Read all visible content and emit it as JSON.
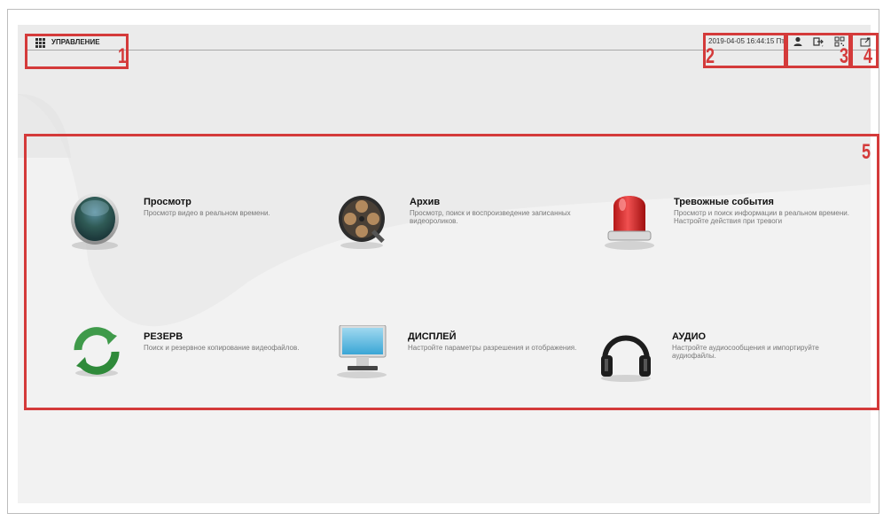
{
  "header": {
    "title": "УПРАВЛЕНИЕ",
    "datetime": "2019-04-05 16:44:15 Пт."
  },
  "toolbar": {
    "icons": [
      "user-icon",
      "logout-icon",
      "qr-code-icon",
      "fullscreen-icon"
    ]
  },
  "annotations": [
    "1",
    "2",
    "3",
    "4",
    "5"
  ],
  "tiles": [
    {
      "title": "Просмотр",
      "desc": "Просмотр видео в реальном времени.",
      "icon": "live-view-icon"
    },
    {
      "title": "Архив",
      "desc": "Просмотр, поиск и воспроизведение записанных видеороликов.",
      "icon": "film-reel-icon"
    },
    {
      "title": "Тревожные события",
      "desc": "Просмотр и поиск информации в реальном времени. Настройте действия при тревоги",
      "icon": "alarm-siren-icon"
    },
    {
      "title": "РЕЗЕРВ",
      "desc": "Поиск и резервное копирование видеофайлов.",
      "icon": "backup-arrows-icon"
    },
    {
      "title": "ДИСПЛЕЙ",
      "desc": "Настройте параметры разрешения и отображения.",
      "icon": "monitor-icon"
    },
    {
      "title": "АУДИО",
      "desc": "Настройте аудиосообщения и импортируйте аудиофайлы.",
      "icon": "headphones-icon"
    }
  ],
  "colors": {
    "annotation": "#d43a3a",
    "background": "#ebebeb"
  }
}
